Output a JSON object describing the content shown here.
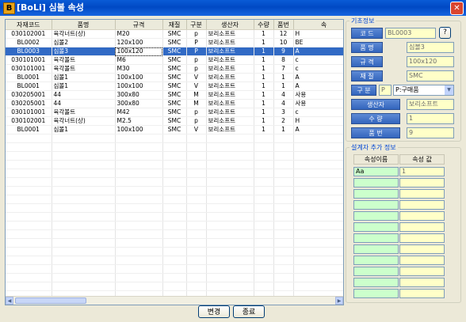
{
  "window": {
    "title": "[BoLi] 심볼 속성",
    "app_icon": "B"
  },
  "grid": {
    "columns": [
      "자재코드",
      "품명",
      "규격",
      "재질",
      "구분",
      "생산자",
      "수량",
      "품번",
      "속"
    ],
    "rows": [
      [
        "030102001",
        "육각너트(상)",
        "M20",
        "SMC",
        "p",
        "보리소프트",
        "1",
        "12",
        "H"
      ],
      [
        "BL0002",
        "심볼2",
        "120x100",
        "SMC",
        "P",
        "보리소프트",
        "1",
        "10",
        "BE"
      ],
      [
        "BL0003",
        "심볼3",
        "100x120",
        "SMC",
        "P",
        "보리소프트",
        "1",
        "9",
        "A"
      ],
      [
        "030101001",
        "육각볼트",
        "M6",
        "SMC",
        "p",
        "보리소프트",
        "1",
        "8",
        "c"
      ],
      [
        "030101001",
        "육각볼트",
        "M30",
        "SMC",
        "p",
        "보리소프트",
        "1",
        "7",
        "c"
      ],
      [
        "BL0001",
        "심볼1",
        "100x100",
        "SMC",
        "V",
        "보리소프트",
        "1",
        "1",
        "A"
      ],
      [
        "BL0001",
        "심볼1",
        "100x100",
        "SMC",
        "V",
        "보리소프트",
        "1",
        "1",
        "A"
      ],
      [
        "030205001",
        "44",
        "300x80",
        "SMC",
        "M",
        "보리소프트",
        "1",
        "4",
        "사용"
      ],
      [
        "030205001",
        "44",
        "300x80",
        "SMC",
        "M",
        "보리소프트",
        "1",
        "4",
        "사용"
      ],
      [
        "030101001",
        "육각볼트",
        "M42",
        "SMC",
        "p",
        "보리소프트",
        "1",
        "3",
        "c"
      ],
      [
        "030102001",
        "육각너트(상)",
        "M2.5",
        "SMC",
        "p",
        "보리소프트",
        "1",
        "2",
        "H"
      ],
      [
        "BL0001",
        "심볼1",
        "100x100",
        "SMC",
        "V",
        "보리소프트",
        "1",
        "1",
        "A"
      ]
    ],
    "selected_row": 2
  },
  "buttons": {
    "change": "변경",
    "exit": "종료",
    "help": "?"
  },
  "basic_info": {
    "legend": "기초정보",
    "code_label": "코 드",
    "code": "BL0003",
    "name_label": "품 명",
    "name": "심볼3",
    "spec_label": "규 격",
    "spec": "100x120",
    "material_label": "재 질",
    "material": "SMC",
    "type_label": "구 분",
    "type_code": "P",
    "type_select": "P:구매품",
    "maker_label": "생산자",
    "maker": "보리소프트",
    "qty_label": "수 량",
    "qty": "1",
    "partno_label": "품 번",
    "partno": "9"
  },
  "designer_info": {
    "legend": "설계자 추가 정보",
    "col_name": "속성이름",
    "col_value": "속성 값",
    "first_name": "Aa",
    "first_value": "1"
  },
  "colors": {
    "title_blue": "#0a5bd6",
    "selection": "#316ac5",
    "field_yellow": "#ffffc8",
    "label_blue": "#3365bd",
    "attr_green": "#ccffcc"
  }
}
